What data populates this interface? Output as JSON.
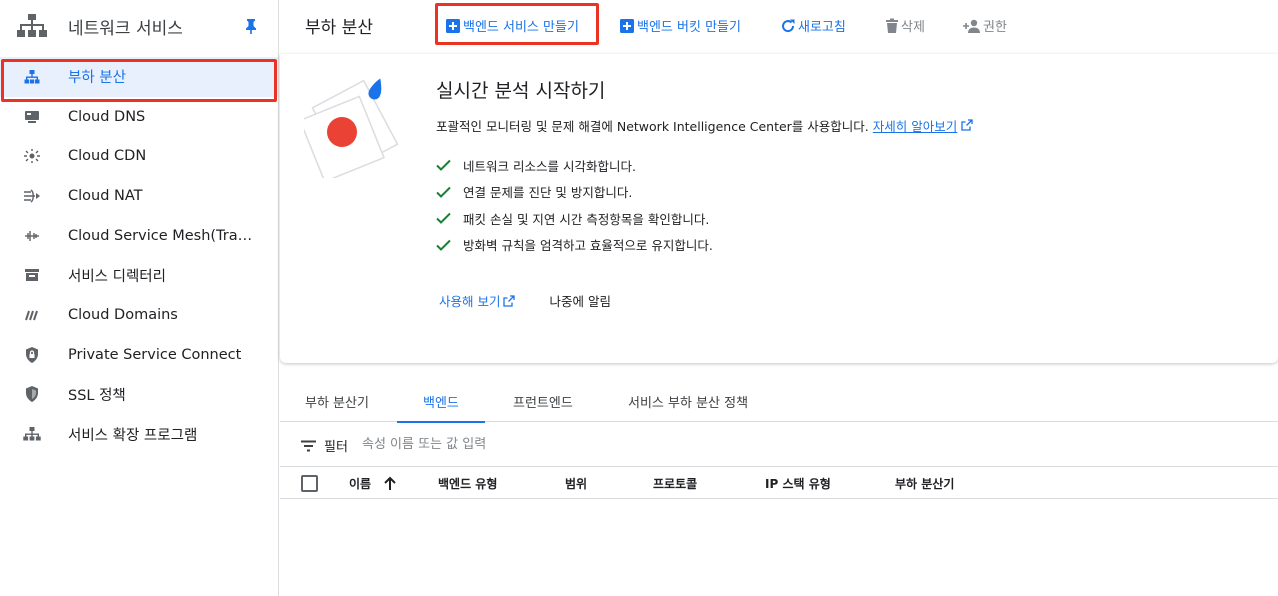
{
  "sidebar": {
    "title": "네트워크 서비스",
    "items": [
      {
        "label": "부하 분산",
        "icon": "load-balancing-icon"
      },
      {
        "label": "Cloud DNS",
        "icon": "dns-icon"
      },
      {
        "label": "Cloud CDN",
        "icon": "cdn-icon"
      },
      {
        "label": "Cloud NAT",
        "icon": "nat-icon"
      },
      {
        "label": "Cloud Service Mesh(Traffic Director)",
        "icon": "service-mesh-icon"
      },
      {
        "label": "서비스 디렉터리",
        "icon": "service-directory-icon"
      },
      {
        "label": "Cloud Domains",
        "icon": "domains-icon"
      },
      {
        "label": "Private Service Connect",
        "icon": "private-service-connect-icon"
      },
      {
        "label": "SSL 정책",
        "icon": "shield-icon"
      },
      {
        "label": "서비스 확장 프로그램",
        "icon": "service-extensions-icon"
      }
    ]
  },
  "header": {
    "title": "부하 분산",
    "actions": {
      "create_backend_service": "백엔드 서비스 만들기",
      "create_backend_bucket": "백엔드 버킷 만들기",
      "refresh": "새로고침",
      "delete": "삭제",
      "permissions": "권한"
    }
  },
  "promo": {
    "title": "실시간 분석 시작하기",
    "description": "포괄적인 모니터링 및 문제 해결에 Network Intelligence Center를 사용합니다.",
    "learn_more": "자세히 알아보기",
    "checks": [
      "네트워크 리소스를 시각화합니다.",
      "연결 문제를 진단 및 방지합니다.",
      "패킷 손실 및 지연 시간 측정항목을 확인합니다.",
      "방화벽 규칙을 엄격하고 효율적으로 유지합니다."
    ],
    "try_it": "사용해 보기",
    "remind_later": "나중에 알림"
  },
  "tabs": [
    "부하 분산기",
    "백엔드",
    "프런트엔드",
    "서비스 부하 분산 정책"
  ],
  "active_tab": "백엔드",
  "filter": {
    "label": "필터",
    "placeholder": "속성 이름 또는 값 입력"
  },
  "table": {
    "columns": [
      "이름",
      "백엔드 유형",
      "범위",
      "프로토콜",
      "IP 스택 유형",
      "부하 분산기"
    ],
    "sort_column": "이름",
    "sort_direction": "ascending"
  },
  "colors": {
    "accent": "#1a73e8",
    "highlight": "#ea3323",
    "check": "#188038"
  }
}
